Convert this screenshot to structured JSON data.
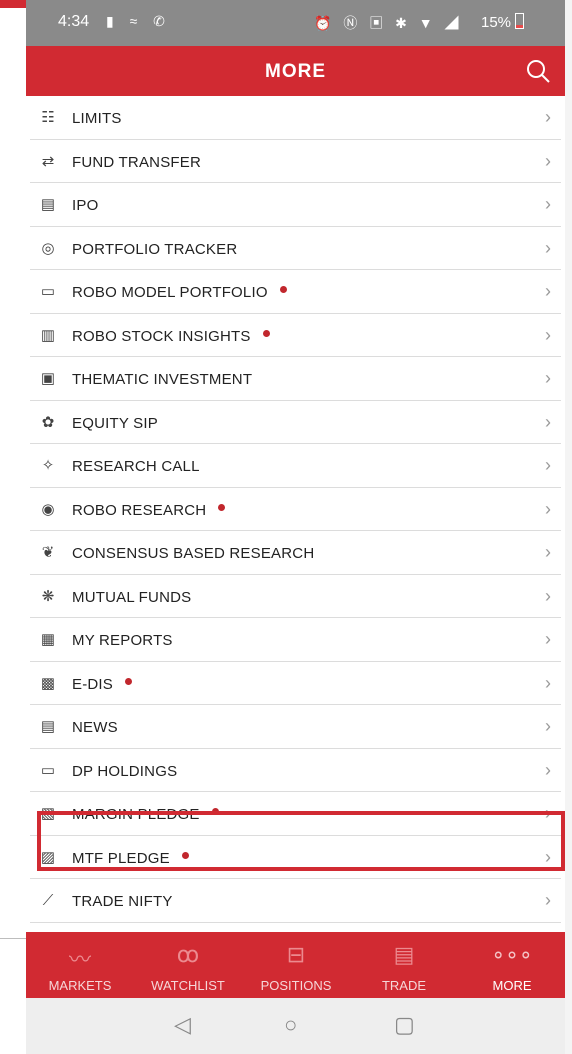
{
  "status_bar": {
    "time": "4:34",
    "battery_percent": "15%"
  },
  "app_bar": {
    "title": "MORE"
  },
  "menu_items": [
    {
      "label": "LIMITS",
      "icon": "limits-icon",
      "new": false
    },
    {
      "label": "FUND TRANSFER",
      "icon": "fund-transfer-icon",
      "new": false
    },
    {
      "label": "IPO",
      "icon": "ipo-icon",
      "new": false
    },
    {
      "label": "PORTFOLIO TRACKER",
      "icon": "portfolio-tracker-icon",
      "new": false
    },
    {
      "label": "ROBO MODEL PORTFOLIO",
      "icon": "briefcase-icon",
      "new": true
    },
    {
      "label": "ROBO STOCK INSIGHTS",
      "icon": "bar-chart-icon",
      "new": true
    },
    {
      "label": "THEMATIC INVESTMENT",
      "icon": "rupee-icon",
      "new": false
    },
    {
      "label": "EQUITY SIP",
      "icon": "sip-icon",
      "new": false
    },
    {
      "label": "RESEARCH CALL",
      "icon": "bulb-icon",
      "new": false
    },
    {
      "label": "ROBO RESEARCH",
      "icon": "magnifier-icon",
      "new": true
    },
    {
      "label": "CONSENSUS BASED RESEARCH",
      "icon": "consensus-icon",
      "new": false
    },
    {
      "label": "MUTUAL FUNDS",
      "icon": "mutual-funds-icon",
      "new": false
    },
    {
      "label": "MY REPORTS",
      "icon": "reports-icon",
      "new": false
    },
    {
      "label": "E-DIS",
      "icon": "edis-icon",
      "new": true
    },
    {
      "label": "NEWS",
      "icon": "news-icon",
      "new": false
    },
    {
      "label": "DP HOLDINGS",
      "icon": "dp-holdings-icon",
      "new": false
    },
    {
      "label": "MARGIN PLEDGE",
      "icon": "margin-pledge-icon",
      "new": true
    },
    {
      "label": "MTF PLEDGE",
      "icon": "mtf-pledge-icon",
      "new": true
    },
    {
      "label": "TRADE NIFTY",
      "icon": "trade-nifty-icon",
      "new": false
    }
  ],
  "highlighted_item": "MARGIN PLEDGE",
  "bottom_nav": [
    {
      "label": "MARKETS",
      "icon": "markets-icon"
    },
    {
      "label": "WATCHLIST",
      "icon": "binoculars-icon"
    },
    {
      "label": "POSITIONS",
      "icon": "briefcase-icon"
    },
    {
      "label": "TRADE",
      "icon": "document-icon"
    },
    {
      "label": "MORE",
      "icon": "more-dots-icon",
      "active": true
    }
  ],
  "colors": {
    "brand_red": "#d12a32",
    "new_dot": "#c1272d",
    "status_bar_gray": "#8a8a8a"
  }
}
